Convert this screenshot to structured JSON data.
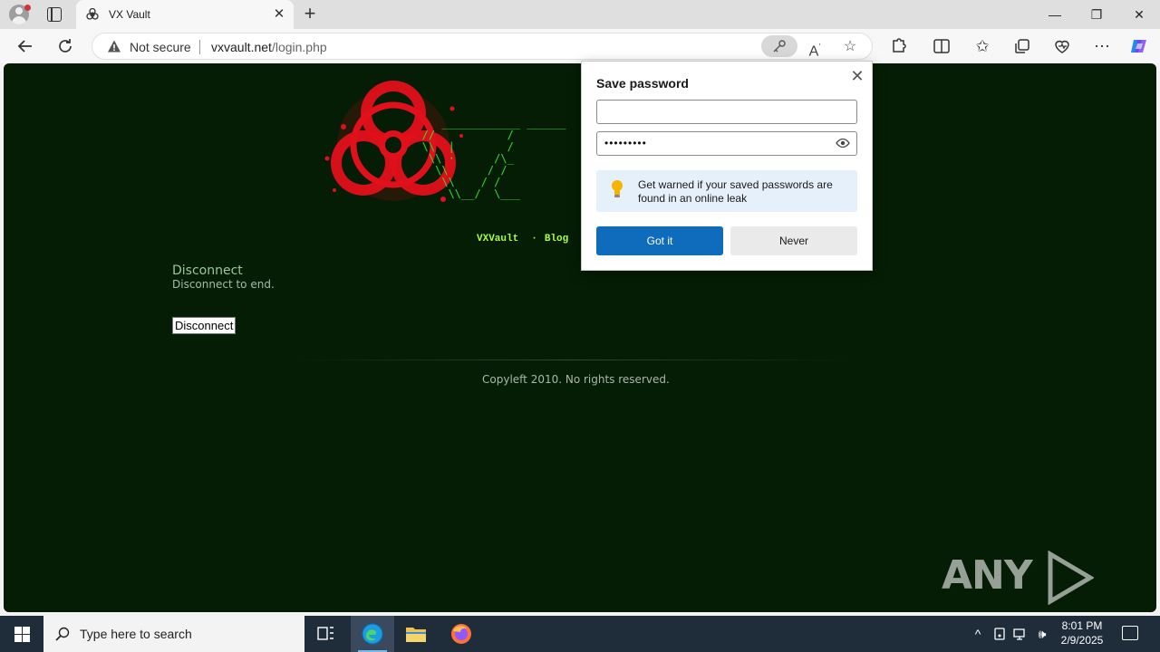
{
  "browser": {
    "tab_title": "VX Vault",
    "tab_close": "✕",
    "new_tab": "+",
    "window_controls": {
      "minimize": "—",
      "restore": "❐",
      "close": "✕"
    },
    "address": {
      "security_label": "Not secure",
      "url_host": "vxvault.net",
      "url_path": "/login.php"
    },
    "icons": [
      "back-icon",
      "refresh-icon",
      "key-icon",
      "read-aloud-icon",
      "favorite-star-icon",
      "extensions-icon",
      "split-screen-icon",
      "favorites-icon",
      "collections-icon",
      "browser-essentials-icon",
      "more-icon",
      "copilot-icon"
    ]
  },
  "page": {
    "ascii_logo": "      ____________ ______\n   //           /\n   \\\\  |        /\n    \\\\ ·      /\\_\n     \\\\      / /\n      \\\\    / /\n       \\\\__/  \\___",
    "nav": {
      "item1": "VXVault",
      "item2": "Blog",
      "separator": "·"
    },
    "section_title": "Disconnect",
    "section_sub": "Disconnect to end.",
    "disconnect_button": "Disconnect",
    "footer": "Copyleft 2010. No rights reserved.",
    "watermark_left": "ANY",
    "watermark_right": "RUN"
  },
  "save_password": {
    "title": "Save password",
    "username_value": "",
    "password_value": "•••••••••",
    "tip": "Get warned if your saved passwords are found in an online leak",
    "primary_button": "Got it",
    "secondary_button": "Never",
    "close_glyph": "✕"
  },
  "taskbar": {
    "search_placeholder": "Type here to search",
    "time": "8:01 PM",
    "date": "2/9/2025"
  },
  "colors": {
    "page_bg": "#041d04",
    "accent_green": "#39d834",
    "nav_green": "#aaff40",
    "biohazard_red": "#e2101a",
    "primary_blue": "#0f6cbd"
  }
}
